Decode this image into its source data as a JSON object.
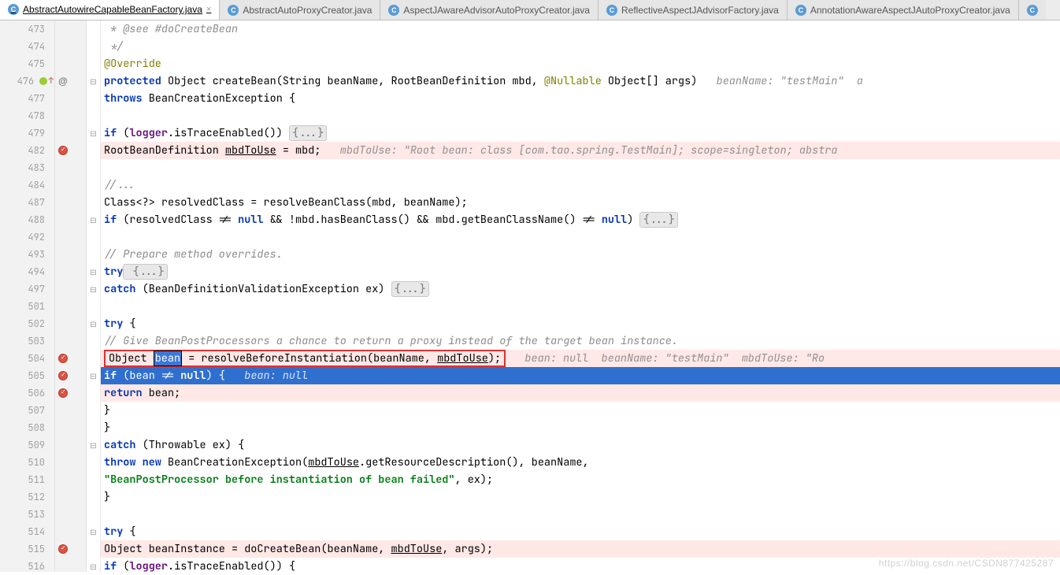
{
  "tabs": [
    {
      "label": "AbstractAutowireCapableBeanFactory.java",
      "active": true,
      "closeable": true
    },
    {
      "label": "AbstractAutoProxyCreator.java",
      "active": false,
      "closeable": false
    },
    {
      "label": "AspectJAwareAdvisorAutoProxyCreator.java",
      "active": false,
      "closeable": false
    },
    {
      "label": "ReflectiveAspectJAdvisorFactory.java",
      "active": false,
      "closeable": false
    },
    {
      "label": "AnnotationAwareAspectJAutoProxyCreator.java",
      "active": false,
      "closeable": false
    }
  ],
  "line_numbers": [
    "473",
    "474",
    "475",
    "476",
    "477",
    "478",
    "479",
    "482",
    "483",
    "484",
    "487",
    "488",
    "492",
    "493",
    "494",
    "497",
    "501",
    "502",
    "503",
    "504",
    "505",
    "506",
    "507",
    "508",
    "509",
    "510",
    "511",
    "512",
    "513",
    "514",
    "515",
    "516"
  ],
  "gutter_extra": {
    "476": "icon"
  },
  "markers": {
    "476": "override",
    "482": "bp",
    "504": "bp",
    "505": "bp",
    "506": "bp",
    "515": "bp"
  },
  "code": {
    "l473": " * @see #doCreateBean",
    "l474": " */",
    "l475_ann": "@Override",
    "l476_pre": "protected",
    "l476_mid1": " Object createBean(String beanName, RootBeanDefinition mbd, ",
    "l476_ann2": "@Nullable",
    "l476_mid2": " Object[] args)",
    "l476_hint": "   beanName: \"testMain\"  a",
    "l477_kw": "throws",
    "l477_rest": " BeanCreationException {",
    "l479_if": "if",
    "l479_mid": " (",
    "l479_fld": "logger",
    "l479_mid2": ".isTraceEnabled()) ",
    "l479_fold": "{...}",
    "l482_a": "RootBeanDefinition ",
    "l482_u": "mbdToUse",
    "l482_b": " = mbd;",
    "l482_hint": "   mbdToUse: \"Root bean: class [com.tao.spring.TestMain]; scope=singleton; abstra",
    "l484": "//...",
    "l487": "Class<?> resolvedClass = resolveBeanClass(mbd, beanName);",
    "l488_if": "if",
    "l488_mid": " (resolvedClass != ",
    "l488_null1": "null",
    "l488_mid2": " && !mbd.hasBeanClass() && mbd.getBeanClassName() != ",
    "l488_null2": "null",
    "l488_mid3": ") ",
    "l488_fold": "{...}",
    "l493": "// Prepare method overrides.",
    "l494_try": "try",
    "l494_fold": " {...}",
    "l497_catch": "catch",
    "l497_mid": " (BeanDefinitionValidationException ex) ",
    "l497_fold": "{...}",
    "l502_try": "try",
    "l502_brace": " {",
    "l503": "// Give BeanPostProcessors a chance to return a proxy instead of the target bean instance.",
    "l504_pre": "Object ",
    "l504_sel": "bean",
    "l504_mid": " = resolveBeforeInstantiation(beanName, ",
    "l504_u": "mbdToUse",
    "l504_end": ");",
    "l504_hint": "   bean: null  beanName: \"testMain\"  mbdToUse: \"Ro",
    "l505_if": "if",
    "l505_mid": " (bean != ",
    "l505_null": "null",
    "l505_mid2": ") {",
    "l505_hint": "   bean: null",
    "l506_ret": "return",
    "l506_rest": " bean;",
    "l507": "}",
    "l508": "}",
    "l509_catch": "catch",
    "l509_rest": " (Throwable ex) {",
    "l510_throw": "throw",
    "l510_new": " new",
    "l510_rest": " BeanCreationException(",
    "l510_u": "mbdToUse",
    "l510_rest2": ".getResourceDescription(), beanName,",
    "l511_str": "\"BeanPostProcessor before instantiation of bean failed\"",
    "l511_rest": ", ex);",
    "l512": "}",
    "l514_try": "try",
    "l514_brace": " {",
    "l515_a": "Object beanInstance = doCreateBean(beanName, ",
    "l515_u": "mbdToUse",
    "l515_b": ", args);",
    "l516_if": "if",
    "l516_mid": " (",
    "l516_fld": "logger",
    "l516_rest": ".isTraceEnabled()) {"
  },
  "watermark": "https://blog.csdn.net/CSDN877425287"
}
